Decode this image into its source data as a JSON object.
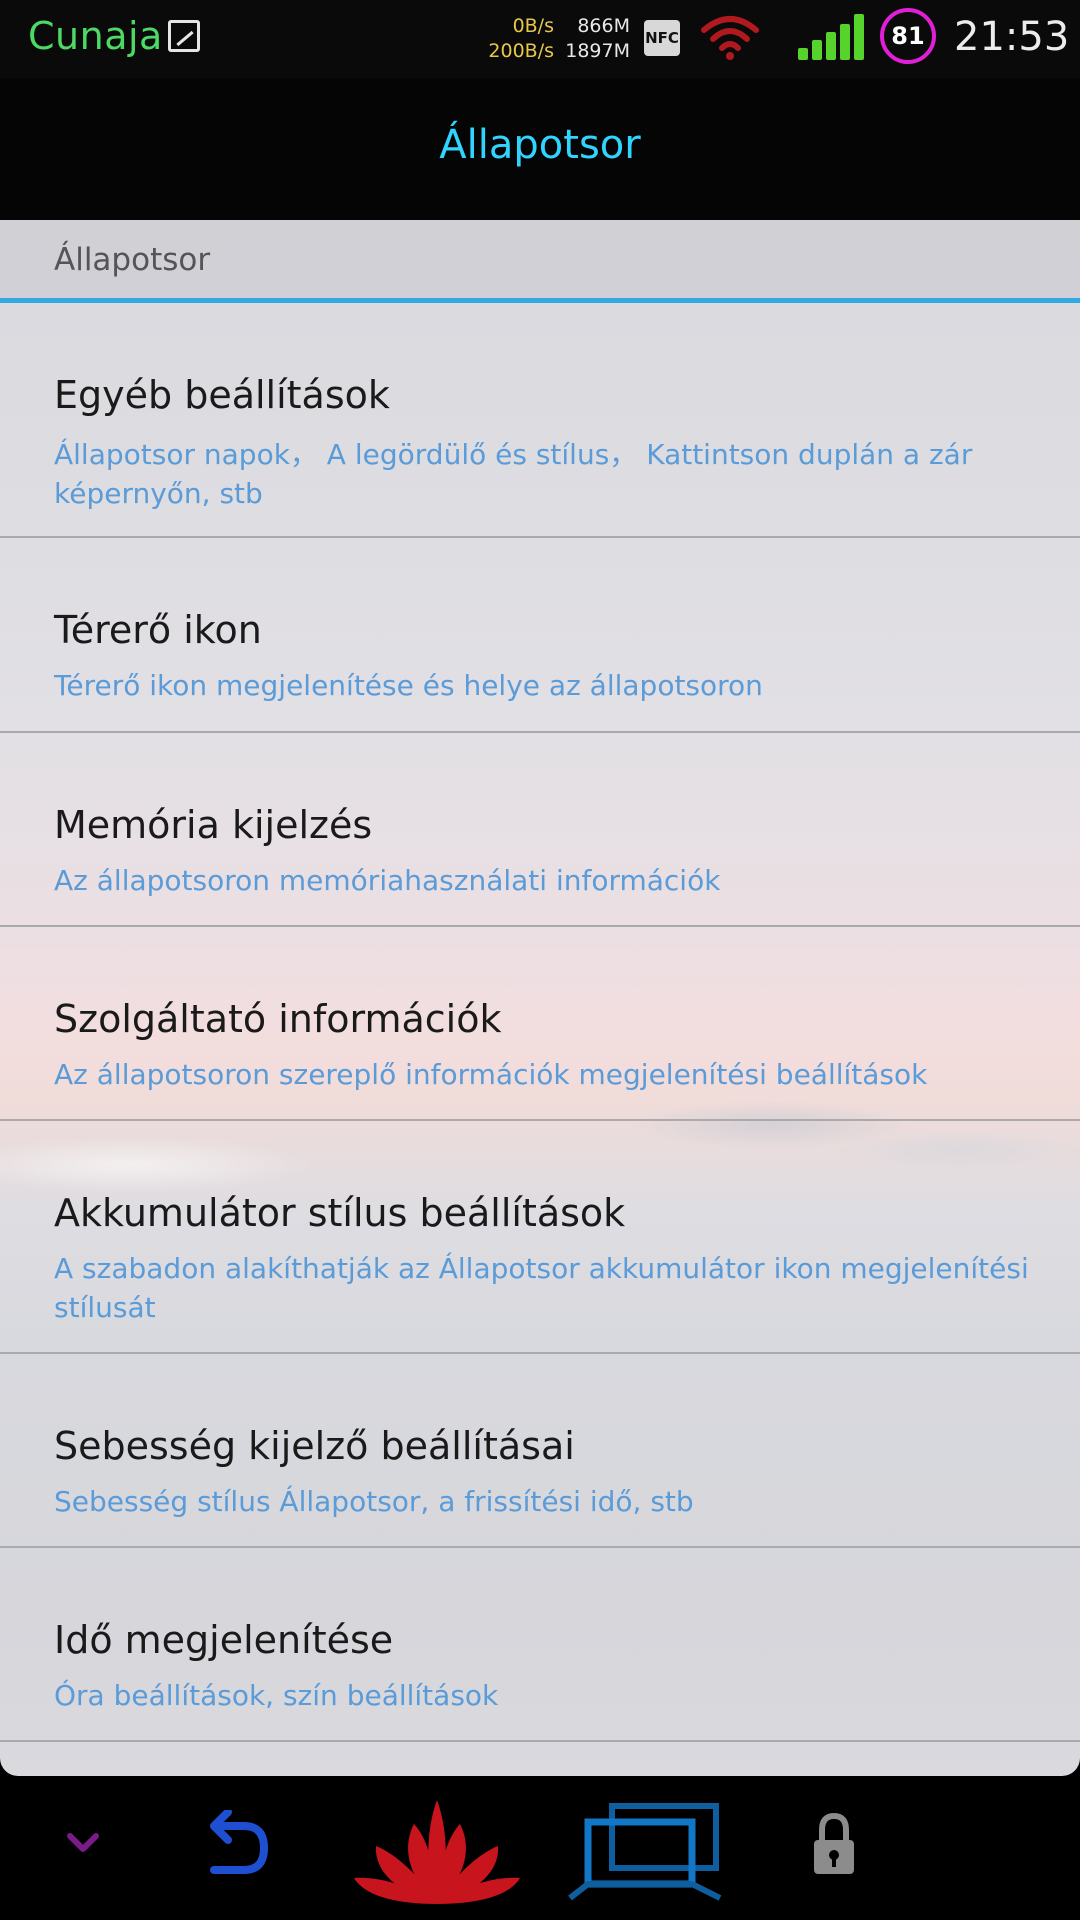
{
  "status_bar": {
    "carrier": "Cunaja",
    "speed_down": "0B/s",
    "speed_up": "200B/s",
    "mem_free": "866M",
    "mem_total": "1897M",
    "nfc_label": "NFC",
    "battery_level": "81",
    "time": "21:53",
    "icons": [
      "picture-icon",
      "nfc-icon",
      "wifi-icon",
      "signal-icon",
      "battery-ring-icon"
    ],
    "colors": {
      "carrier": "#4cd964",
      "speed": "#e6c84a",
      "wifi": "#b0191e",
      "signal": "#56d42c",
      "battery_ring": "#e01fd7"
    }
  },
  "title_bar": {
    "title": "Állapotsor",
    "color": "#2fd4ff"
  },
  "section": {
    "header": "Állapotsor",
    "accent": "#2fa9e0"
  },
  "items": [
    {
      "title": "Egyéb beállítások",
      "subtitle": "Állapotsor napok， A legördülő és stílus， Kattintson duplán a zár képernyőn, stb"
    },
    {
      "title": "Térerő ikon",
      "subtitle": "Térerő ikon megjelenítése és helye az állapotsoron"
    },
    {
      "title": "Memória kijelzés",
      "subtitle": "Az állapotsoron memóriahasználati információk"
    },
    {
      "title": "Szolgáltató információk",
      "subtitle": "Az állapotsoron szereplő információk megjelenítési beállítások"
    },
    {
      "title": "Akkumulátor stílus beállítások",
      "subtitle": "A szabadon alakíthatják az Állapotsor akkumulátor ikon megjelenítési stílusát"
    },
    {
      "title": "Sebesség kijelző beállításai",
      "subtitle": "Sebesség stílus Állapotsor, a frissítési idő, stb"
    },
    {
      "title": "Idő megjelenítése",
      "subtitle": "Óra beállítások, szín beállítások"
    }
  ],
  "nav_bar": {
    "buttons": [
      "chevron-down-icon",
      "back-icon",
      "huawei-logo-icon",
      "recent-apps-icon",
      "lock-icon"
    ]
  }
}
